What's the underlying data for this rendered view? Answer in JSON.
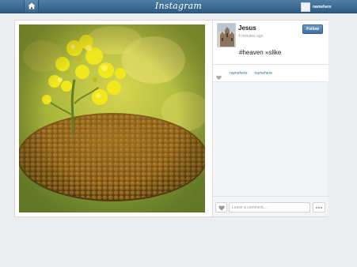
{
  "topbar": {
    "brand": "Instagram",
    "username": "namehere",
    "icons": {
      "home": "home-icon"
    }
  },
  "post": {
    "author": "Jesus",
    "timestamp": "4 minutes ago",
    "follow_label": "Follow",
    "caption": "#heaven »slike",
    "likers": [
      "namehere",
      "namehere"
    ],
    "photo_subject": "yellow-flower-photo"
  },
  "comment": {
    "placeholder": "Leave a comment..."
  },
  "colors": {
    "topbar": "#3a6690",
    "accent_link": "#3c75a8",
    "background": "#ecedef"
  }
}
